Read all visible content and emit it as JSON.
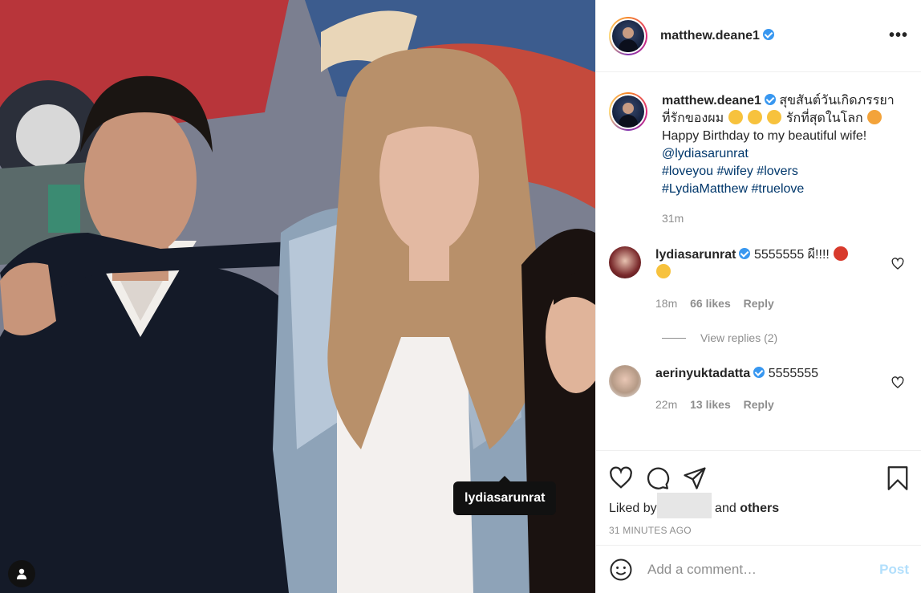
{
  "post": {
    "tooltip_tag": "lydiasarunrat",
    "author": "matthew.deane1"
  },
  "caption": {
    "username": "matthew.deane1",
    "text_thai_1": "สุขสันต์วันเกิดภรรยาที่รักของผม",
    "text_thai_2": "รักที่สุดในโลก",
    "text_en": "Happy Birthday to my beautiful wife!",
    "mention": "@lydiasarunrat",
    "hashtags_1": "#loveyou #wifey #lovers",
    "hashtags_2": "#LydiaMatthew #truelove",
    "time": "31m"
  },
  "comments": [
    {
      "username": "lydiasarunrat",
      "text": "5555555 ผี!!!!",
      "time": "18m",
      "likes": "66 likes",
      "reply": "Reply",
      "view_replies": "View replies (2)"
    },
    {
      "username": "aerinyuktadatta",
      "text": "5555555",
      "time": "22m",
      "likes": "13 likes",
      "reply": "Reply"
    }
  ],
  "likes": {
    "prefix": "Liked by",
    "middle": "and",
    "others": "others"
  },
  "posted_ago": "31 MINUTES AGO",
  "add_comment": {
    "placeholder": "Add a comment…",
    "post_label": "Post"
  },
  "colors": {
    "verified": "#3897f0",
    "link": "#00376b",
    "post_disabled": "#b2dffc"
  }
}
